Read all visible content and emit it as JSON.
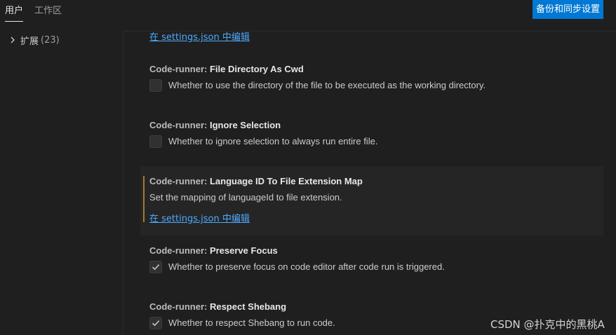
{
  "tabs": [
    {
      "label": "用户",
      "active": true
    },
    {
      "label": "工作区",
      "active": false
    }
  ],
  "sync_button": "备份和同步设置",
  "sidebar": {
    "items": [
      {
        "label": "扩展",
        "count": "(23)",
        "icon": "chevron-right-icon"
      }
    ]
  },
  "top_link": "在 settings.json 中编辑",
  "settings": [
    {
      "category": "Code-runner: ",
      "name": "File Directory As Cwd",
      "type": "checkbox",
      "checked": false,
      "description": "Whether to use the directory of the file to be executed as the working directory."
    },
    {
      "category": "Code-runner: ",
      "name": "Ignore Selection",
      "type": "checkbox",
      "checked": false,
      "description": "Whether to ignore selection to always run entire file."
    },
    {
      "category": "Code-runner: ",
      "name": "Language ID To File Extension Map",
      "type": "object",
      "focused": true,
      "description": "Set the mapping of languageId to file extension.",
      "link": "在 settings.json 中编辑"
    },
    {
      "category": "Code-runner: ",
      "name": "Preserve Focus",
      "type": "checkbox",
      "checked": true,
      "description": "Whether to preserve focus on code editor after code run is triggered."
    },
    {
      "category": "Code-runner: ",
      "name": "Respect Shebang",
      "type": "checkbox",
      "checked": true,
      "description": "Whether to respect Shebang to run code."
    }
  ],
  "watermark": "CSDN @扑克中的黑桃A",
  "colors": {
    "background": "#1f1f1f",
    "accent_button": "#0078d4",
    "link": "#4daafc",
    "focus_bar": "#a17d2a",
    "focused_row": "#252526"
  }
}
